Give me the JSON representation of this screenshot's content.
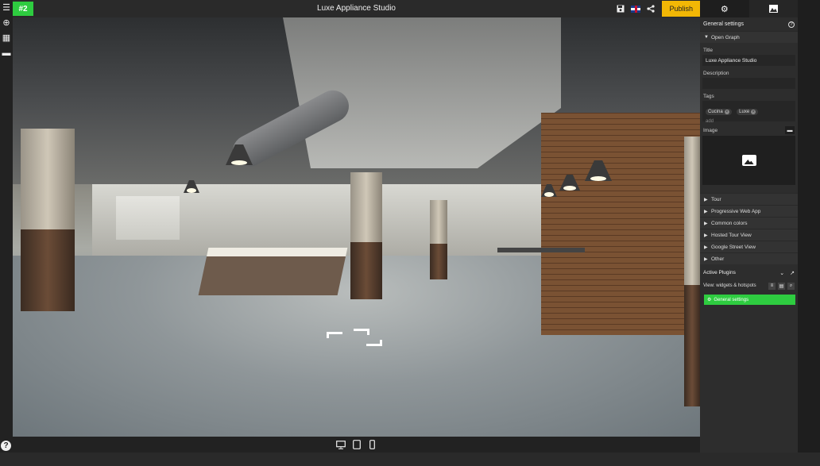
{
  "rail": {
    "icons": [
      "menu-icon",
      "add-icon",
      "widgets-icon",
      "folder-icon"
    ],
    "help": "?"
  },
  "topbar": {
    "badge": "#2",
    "title": "Luxe Appliance Studio",
    "publish_label": "Publish"
  },
  "panel": {
    "section_title": "General settings",
    "open_graph": {
      "header": "Open Graph",
      "title_label": "Title",
      "title_value": "Luxe Appliance Studio",
      "description_label": "Description",
      "description_value": "",
      "tags_label": "Tags",
      "tags": [
        "Cucina",
        "Luxe"
      ],
      "tags_add": "add",
      "image_label": "Image"
    },
    "accordions": [
      "Tour",
      "Progressive Web App",
      "Common colors",
      "Hosted Tour View",
      "Google Street View",
      "Other"
    ],
    "active_plugins_label": "Active Plugins",
    "view_label": "View: widgets & hotspots",
    "plugin_button": "General settings"
  },
  "colors": {
    "accent_green": "#2ecc40",
    "publish_yellow": "#f2b705"
  }
}
